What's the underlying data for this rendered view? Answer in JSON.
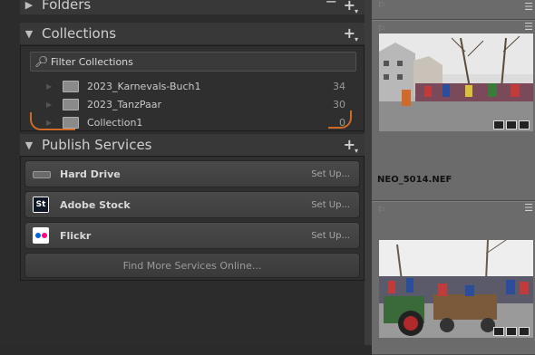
{
  "panels": {
    "folders": {
      "title": "Folders"
    },
    "collections": {
      "title": "Collections",
      "filter_placeholder": "Filter Collections",
      "items": [
        {
          "name": "2023_Karnevals-Buch1",
          "count": "34"
        },
        {
          "name": "2023_TanzPaar",
          "count": "30"
        },
        {
          "name": "Collection1",
          "count": "0"
        }
      ]
    },
    "publish": {
      "title": "Publish Services",
      "services": [
        {
          "name": "Hard Drive",
          "action": "Set Up...",
          "icon": "hard-drive-icon"
        },
        {
          "name": "Adobe Stock",
          "action": "Set Up...",
          "icon": "adobe-stock-icon",
          "icon_text": "St"
        },
        {
          "name": "Flickr",
          "action": "Set Up...",
          "icon": "flickr-icon"
        }
      ],
      "find_more": "Find More Services Online..."
    }
  },
  "grid": {
    "photos": [
      {
        "filename": "NEO_5014.NEF",
        "scene": "parade-street-crowd"
      },
      {
        "filename": "",
        "scene": "parade-tractor"
      }
    ]
  },
  "colors": {
    "annotation": "#d06a2a",
    "flickr_blue": "#0063dc",
    "flickr_pink": "#ff0084"
  }
}
